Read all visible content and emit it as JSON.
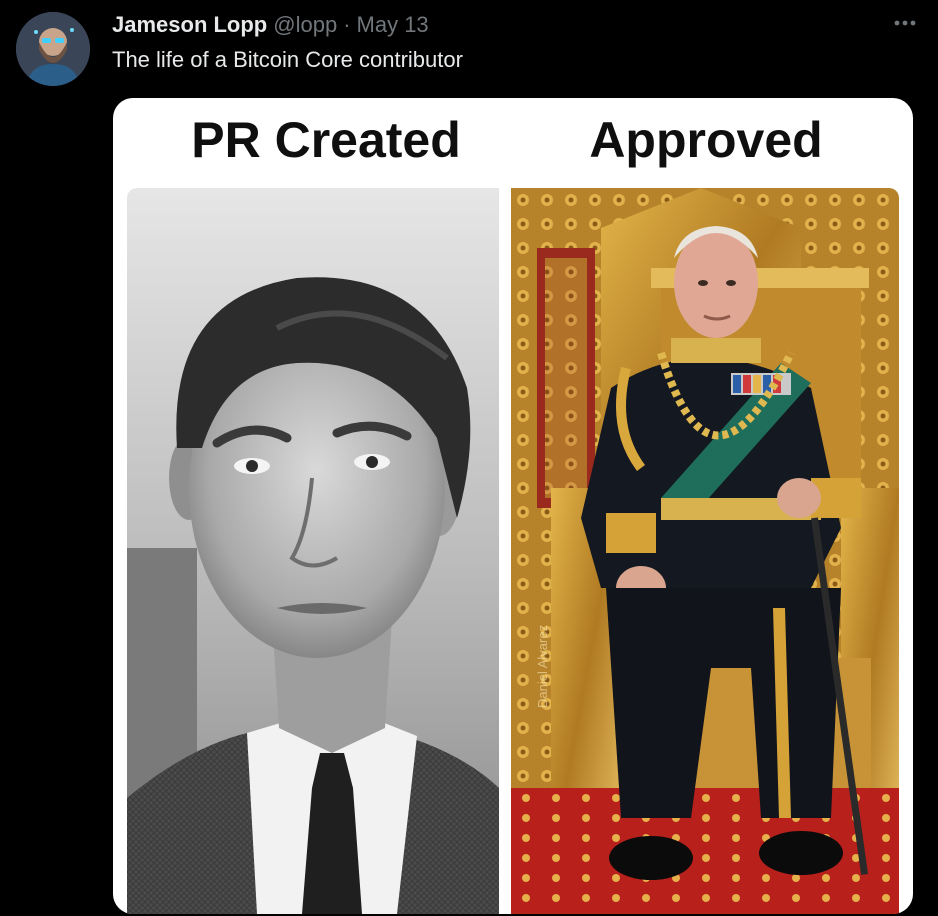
{
  "tweet": {
    "author_name": "Jameson Lopp",
    "handle": "@lopp",
    "separator": "·",
    "date": "May 13",
    "text": "The life of a Bitcoin Core contributor",
    "more_icon": "ellipsis-icon"
  },
  "media": {
    "left_caption": "PR Created",
    "right_caption": "Approved",
    "watermark": "Daniel Alvarez"
  },
  "colors": {
    "background": "#000000",
    "primary_text": "#e7e9ea",
    "secondary_text": "#71767b"
  }
}
